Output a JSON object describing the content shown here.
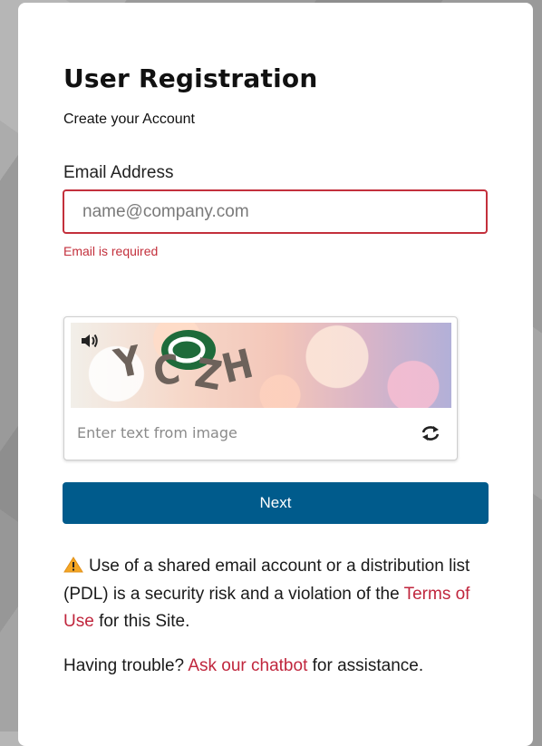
{
  "page": {
    "title": "User Registration",
    "subtitle": "Create your Account"
  },
  "email": {
    "label": "Email Address",
    "placeholder": "name@company.com",
    "value": "",
    "error": "Email is required"
  },
  "captcha": {
    "image_text": "YCZH",
    "input_placeholder": "Enter text from image",
    "audio_icon": "speaker-icon",
    "refresh_icon": "refresh-icon"
  },
  "actions": {
    "next_label": "Next"
  },
  "notice": {
    "icon": "warning-icon",
    "text_before": "Use of a shared email account or a distribution list (PDL) is a security risk and a violation of the",
    "link_text": "Terms of Use",
    "text_after": "for this Site."
  },
  "help": {
    "prefix": "Having trouble?",
    "link_text": "Ask our chatbot",
    "suffix": "for assistance."
  },
  "colors": {
    "accent": "#005b8c",
    "error": "#c3303c",
    "link": "#c0263d",
    "warning": "#f5a623"
  }
}
